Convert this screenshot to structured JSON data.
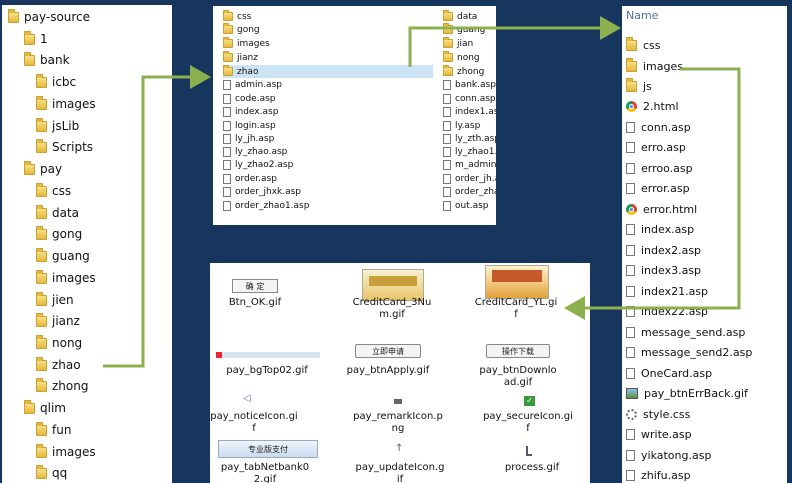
{
  "tree": {
    "root": "pay-source",
    "items": [
      "1",
      "bank",
      "icbc",
      "images",
      "jsLib",
      "Scripts",
      "pay",
      "css",
      "data",
      "gong",
      "guang",
      "images",
      "jien",
      "jianz",
      "nong",
      "zhao",
      "zhong",
      "qlim",
      "fun",
      "images",
      "qq"
    ]
  },
  "asp_list": {
    "left": [
      "css",
      "gong",
      "images",
      "jianz",
      "zhao",
      "admin.asp",
      "code.asp",
      "index.asp",
      "login.asp",
      "ly_jh.asp",
      "ly_zhao.asp",
      "ly_zhao2.asp",
      "order.asp",
      "order_jhxk.asp",
      "order_zhao1.asp"
    ],
    "right": [
      "data",
      "guang",
      "jian",
      "nong",
      "zhong",
      "bank.asp",
      "conn.asp",
      "index1.asp",
      "ly.asp",
      "ly_zth.asp",
      "ly_zhao1.asp",
      "m_admin.asp",
      "order_jh.asp",
      "order_zhao.asp",
      "out.asp"
    ]
  },
  "images": {
    "items": [
      {
        "caption": "Btn_OK.gif",
        "text": "确  定"
      },
      {
        "caption": "CreditCard_3Nu\nm.gif",
        "text": ""
      },
      {
        "caption": "CreditCard_YL.gi\nf",
        "text": ""
      },
      {
        "caption": "pay_bgTop02.gif",
        "text": ""
      },
      {
        "caption": "pay_btnApply.gif",
        "text": "立即申请"
      },
      {
        "caption": "pay_btnDownlo\nad.gif",
        "text": "操作下载"
      },
      {
        "caption": "pay_noticeIcon.gi\nf",
        "text": ""
      },
      {
        "caption": "pay_remarkIcon.p\nng",
        "text": ""
      },
      {
        "caption": "pay_secureIcon.gi\nf",
        "text": ""
      },
      {
        "caption": "pay_tabNetbank0\n2.gif",
        "text": "专业版支付"
      },
      {
        "caption": "pay_updateIcon.g\nif",
        "text": ""
      },
      {
        "caption": "process.gif",
        "text": ""
      }
    ]
  },
  "name_list": {
    "header": "Name",
    "items": [
      "css",
      "images",
      "js",
      "2.html",
      "conn.asp",
      "erro.asp",
      "erroo.asp",
      "error.asp",
      "error.html",
      "index.asp",
      "index2.asp",
      "index3.asp",
      "index21.asp",
      "index22.asp",
      "message_send.asp",
      "message_send2.asp",
      "OneCard.asp",
      "pay_btnErrBack.gif",
      "style.css",
      "write.asp",
      "yikatong.asp",
      "zhifu.asp"
    ]
  },
  "colors": {
    "arrow": "#8db04f",
    "background": "#17365d",
    "selection": "#cde4f7"
  }
}
